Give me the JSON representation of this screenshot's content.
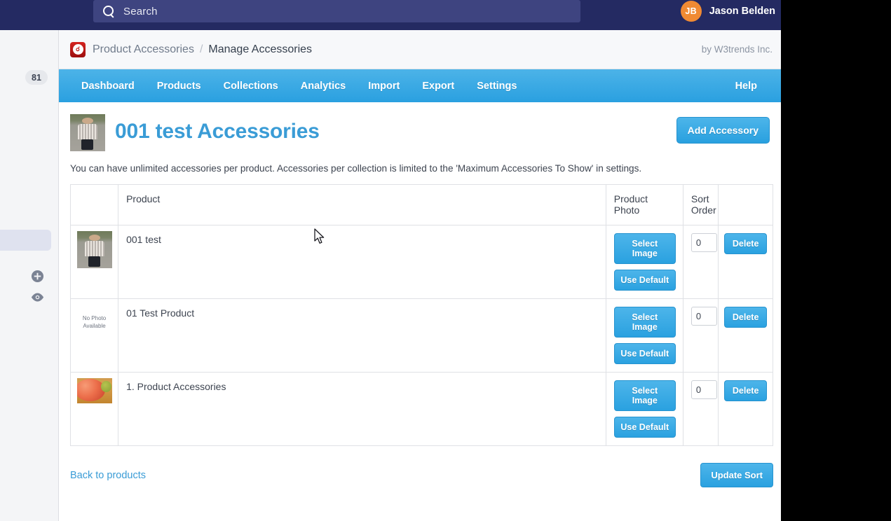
{
  "topbar": {
    "search": {
      "placeholder": "Search",
      "icon": "search-icon"
    },
    "user": {
      "initials": "JB",
      "name": "Jason Belden"
    }
  },
  "sidebar": {
    "badge_count": "81",
    "icons": [
      "plus-icon",
      "eye-icon"
    ]
  },
  "breadcrumb": {
    "app_label": "Product Accessories",
    "separator": "/",
    "page_label": "Manage Accessories",
    "vendor": "by W3trends Inc."
  },
  "nav": {
    "items": [
      {
        "label": "Dashboard"
      },
      {
        "label": "Products"
      },
      {
        "label": "Collections"
      },
      {
        "label": "Analytics"
      },
      {
        "label": "Import"
      },
      {
        "label": "Export"
      },
      {
        "label": "Settings"
      }
    ],
    "help_label": "Help"
  },
  "main": {
    "page_title": "001 test Accessories",
    "add_button": "Add Accessory",
    "description": "You can have unlimited accessories per product. Accessories per collection is limited to the 'Maximum Accessories To Show' in settings.",
    "table": {
      "headers": [
        "",
        "Product",
        "Product Photo",
        "Sort Order",
        ""
      ],
      "rows": [
        {
          "thumb_kind": "person-photo",
          "thumb_text": "",
          "product": "001 test",
          "select_image_label": "Select Image",
          "use_default_label": "Use Default",
          "sort_order": "0",
          "delete_label": "Delete"
        },
        {
          "thumb_kind": "no-photo",
          "thumb_text": "No Photo Available",
          "product": "01 Test Product",
          "select_image_label": "Select Image",
          "use_default_label": "Use Default",
          "sort_order": "0",
          "delete_label": "Delete"
        },
        {
          "thumb_kind": "apple-photo",
          "thumb_text": "",
          "product": "1. Product Accessories",
          "select_image_label": "Select Image",
          "use_default_label": "Use Default",
          "sort_order": "0",
          "delete_label": "Delete"
        }
      ]
    },
    "back_link": "Back to products",
    "update_sort": "Update Sort"
  },
  "colors": {
    "topbar_navy": "#242a62",
    "search_field": "#3e4480",
    "avatar_orange": "#f08a33",
    "nav_blue": "#2aa0e0",
    "button_blue": "#2aa1e0",
    "title_blue": "#3a9cd6",
    "logo_red": "#c2201c",
    "sidebar_bg": "#f4f5f7",
    "page_bg": "#ffffff",
    "outside_bg": "#000000"
  }
}
